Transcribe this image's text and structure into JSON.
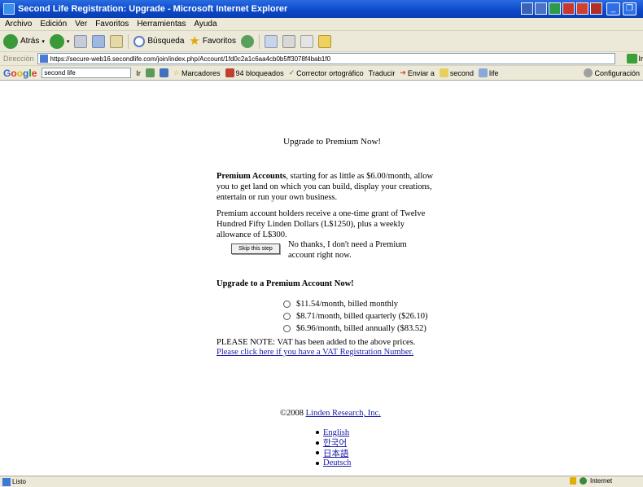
{
  "window": {
    "title": "Second Life Registration: Upgrade - Microsoft Internet Explorer"
  },
  "menu": {
    "items": [
      "Archivo",
      "Edición",
      "Ver",
      "Favoritos",
      "Herramientas",
      "Ayuda"
    ]
  },
  "toolbar": {
    "back_label": "Atrás",
    "search_label": "Búsqueda",
    "favorites_label": "Favoritos"
  },
  "address": {
    "label": "Dirección",
    "url": "https://secure-web16.secondlife.com/join/index.php/Account/1fd0c2a1c6aa4cb0b5ff3078f4bab1f0",
    "go_label": "Ir"
  },
  "googlebar": {
    "search_value": "second life",
    "go_label": "Ir",
    "bookmarks_label": "Marcadores",
    "blocked_label": "94 bloqueados",
    "spell_label": "Corrector ortográfico",
    "translate_label": "Traducir",
    "send_label": "Enviar a",
    "term1": "second",
    "term2": "life",
    "settings_label": "Configuración"
  },
  "page": {
    "title": "Upgrade to Premium Now!",
    "premium_bold": "Premium Accounts",
    "premium_text": ", starting for as little as $6.00/month, allow you to get land on which you can build, display your creations, entertain or run your own business.",
    "grant_text": "Premium account holders receive a one-time grant of Twelve Hundred Fifty Linden Dollars (L$1250), plus a weekly allowance of L$300.",
    "skip_button": "Skip this step",
    "skip_text": "No thanks, I don't need a Premium account right now.",
    "upgrade_heading": "Upgrade to a Premium Account Now!",
    "plans": [
      "$11.54/month, billed monthly",
      "$8.71/month, billed quarterly ($26.10)",
      "$6.96/month, billed annually ($83.52)"
    ],
    "vat_note": "PLEASE NOTE: VAT has been added to the above prices.",
    "vat_link": "Please click here if you have a VAT Registration Number.",
    "copyright_prefix": "©2008 ",
    "copyright_link": "Linden Research, Inc.",
    "languages": [
      "English",
      "한국어",
      "日本語",
      "Deutsch"
    ]
  },
  "status": {
    "left_text": "Listo",
    "zone_text": "Internet"
  }
}
